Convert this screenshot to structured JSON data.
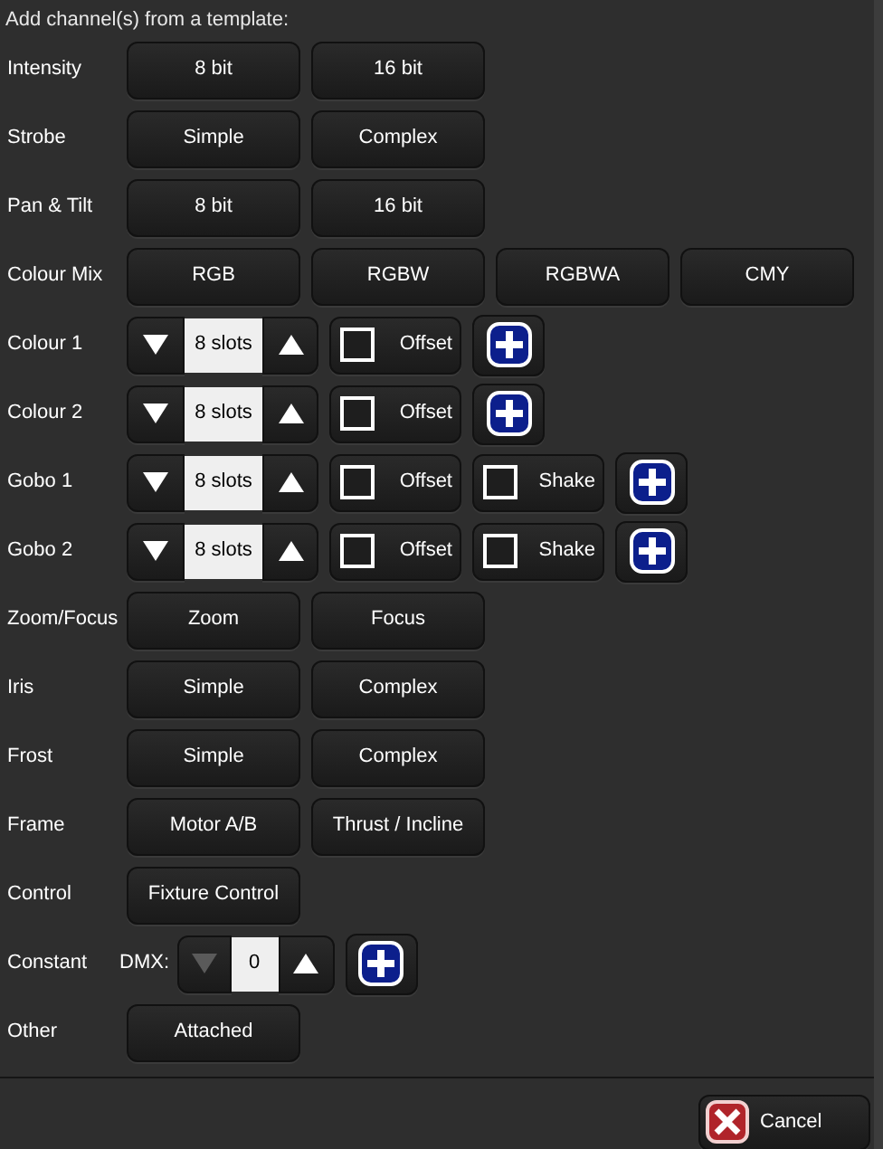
{
  "heading": "Add channel(s) from a template:",
  "rows": [
    {
      "label": "Intensity",
      "items": [
        {
          "kind": "button",
          "text": "8 bit"
        },
        {
          "kind": "button",
          "text": "16 bit"
        }
      ]
    },
    {
      "label": "Strobe",
      "items": [
        {
          "kind": "button",
          "text": "Simple"
        },
        {
          "kind": "button",
          "text": "Complex"
        }
      ]
    },
    {
      "label": "Pan & Tilt",
      "items": [
        {
          "kind": "button",
          "text": "8 bit"
        },
        {
          "kind": "button",
          "text": "16 bit"
        }
      ]
    },
    {
      "label": "Colour Mix",
      "items": [
        {
          "kind": "button",
          "text": "RGB"
        },
        {
          "kind": "button",
          "text": "RGBW"
        },
        {
          "kind": "button",
          "text": "RGBWA"
        },
        {
          "kind": "button",
          "text": "CMY"
        }
      ]
    },
    {
      "label": "Colour 1",
      "items": [
        {
          "kind": "spinner",
          "value": "8 slots",
          "down_disabled": false
        },
        {
          "kind": "checkbox",
          "text": "Offset",
          "checked": false
        },
        {
          "kind": "add"
        }
      ]
    },
    {
      "label": "Colour 2",
      "items": [
        {
          "kind": "spinner",
          "value": "8 slots",
          "down_disabled": false
        },
        {
          "kind": "checkbox",
          "text": "Offset",
          "checked": false
        },
        {
          "kind": "add"
        }
      ]
    },
    {
      "label": "Gobo 1",
      "items": [
        {
          "kind": "spinner",
          "value": "8 slots",
          "down_disabled": false
        },
        {
          "kind": "checkbox",
          "text": "Offset",
          "checked": false
        },
        {
          "kind": "checkbox",
          "text": "Shake",
          "checked": false
        },
        {
          "kind": "add"
        }
      ]
    },
    {
      "label": "Gobo 2",
      "items": [
        {
          "kind": "spinner",
          "value": "8 slots",
          "down_disabled": false
        },
        {
          "kind": "checkbox",
          "text": "Offset",
          "checked": false
        },
        {
          "kind": "checkbox",
          "text": "Shake",
          "checked": false
        },
        {
          "kind": "add"
        }
      ]
    },
    {
      "label": "Zoom/Focus",
      "items": [
        {
          "kind": "button",
          "text": "Zoom"
        },
        {
          "kind": "button",
          "text": "Focus"
        }
      ]
    },
    {
      "label": "Iris",
      "items": [
        {
          "kind": "button",
          "text": "Simple"
        },
        {
          "kind": "button",
          "text": "Complex"
        }
      ]
    },
    {
      "label": "Frost",
      "items": [
        {
          "kind": "button",
          "text": "Simple"
        },
        {
          "kind": "button",
          "text": "Complex"
        }
      ]
    },
    {
      "label": "Frame",
      "items": [
        {
          "kind": "button",
          "text": "Motor A/B"
        },
        {
          "kind": "button",
          "text": "Thrust / Incline"
        }
      ]
    },
    {
      "label": "Control",
      "items": [
        {
          "kind": "button",
          "text": "Fixture Control"
        }
      ]
    },
    {
      "label": "Constant",
      "items": [
        {
          "kind": "prefix",
          "text": "DMX:"
        },
        {
          "kind": "spinner",
          "value": "0",
          "down_disabled": true
        },
        {
          "kind": "add"
        }
      ]
    },
    {
      "label": "Other",
      "items": [
        {
          "kind": "button",
          "text": "Attached"
        }
      ]
    }
  ],
  "cancel_button": "Cancel"
}
